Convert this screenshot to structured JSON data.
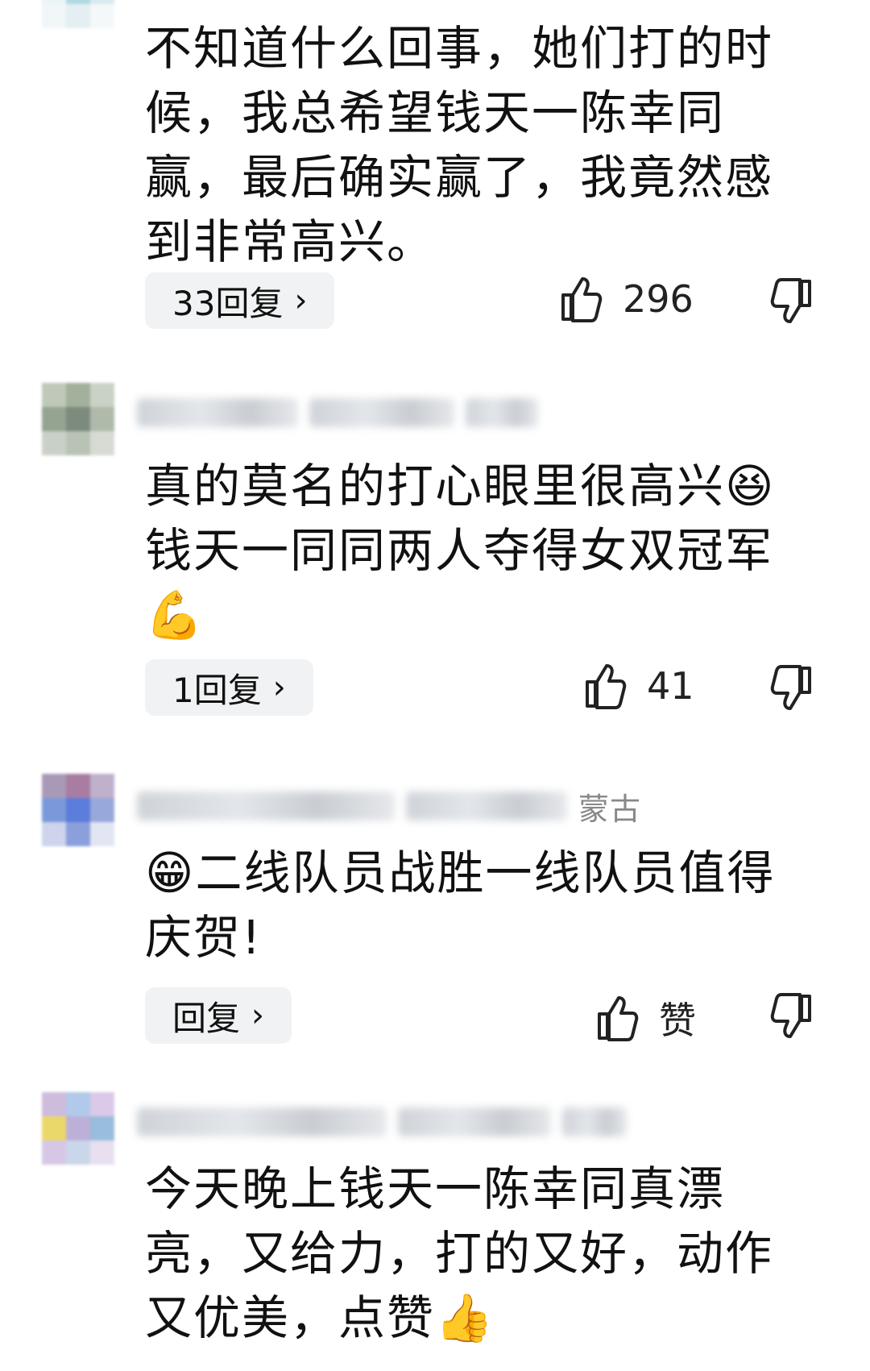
{
  "comments": [
    {
      "text_lines": [
        "不知道什么回事，她们打的时",
        "候，我总希望钱天一陈幸同",
        "赢，最后确实赢了，我竟然感",
        "到非常高兴。"
      ],
      "reply_label": "33回复",
      "like_label": "296",
      "avatar_colors": [
        "#c7e6ef",
        "#d8eef3",
        "#bde0ea",
        "#e9f3f6",
        "#a9d5e2",
        "#d3e9ef",
        "#f0f6f8",
        "#e2eef2",
        "#f4f8f9"
      ]
    },
    {
      "text_lines": [
        "真的莫名的打心眼里很高兴",
        "钱天一同同两人夺得女双冠军",
        ""
      ],
      "emoji_after_line1": "😆",
      "emoji_line3": "💪",
      "reply_label": "1回复",
      "like_label": "41",
      "avatar_colors": [
        "#b8c4b2",
        "#9aa892",
        "#c5cdc0",
        "#8a9a86",
        "#6f7f70",
        "#a7b3a3",
        "#c4ccc1",
        "#b1bcae",
        "#d3d8d0"
      ]
    },
    {
      "location": "蒙古",
      "emoji_before": "😁",
      "text_lines": [
        "二线队员战胜一线队员值得",
        "庆贺!"
      ],
      "reply_label": "回复",
      "like_label": "赞",
      "avatar_colors": [
        "#9f8fb0",
        "#a06f9a",
        "#b9a8c7",
        "#6d8fd6",
        "#4a6fd8",
        "#8e9fd6",
        "#c8d0ea",
        "#7e95d8",
        "#dfe4f2"
      ]
    },
    {
      "text_lines": [
        "今天晚上钱天一陈幸同真漂",
        "亮，又给力，打的又好，动作",
        "又优美，点赞"
      ],
      "emoji_end": "👍",
      "avatar_colors": [
        "#c9b5d9",
        "#a9c4e8",
        "#d7c4e6",
        "#e8d55a",
        "#b7a7d4",
        "#8fb6d9",
        "#d2c2e4",
        "#c5d3e8",
        "#e6dcef"
      ]
    }
  ],
  "icons": {
    "like": "thumbs-up-icon",
    "dislike": "thumbs-down-icon",
    "chevron": "chevron-right-icon"
  }
}
